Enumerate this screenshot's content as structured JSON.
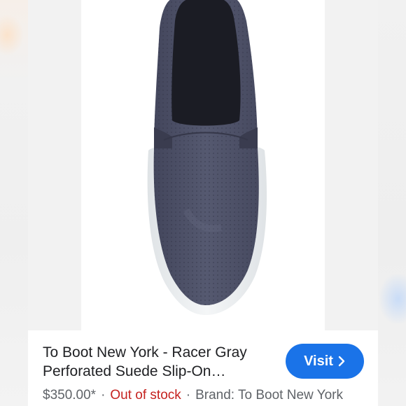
{
  "product": {
    "title_line1": "To Boot New York - Racer Gray",
    "title_line2": "Perforated Suede Slip-On…",
    "price": "$350.00*",
    "separator": "·",
    "stock_status": "Out of stock",
    "brand_text": "Brand: To Boot New York",
    "image_icon": "slip-on-shoe-photo"
  },
  "actions": {
    "visit_label": "Visit",
    "visit_icon": "chevron-right-icon"
  },
  "colors": {
    "accent": "#1a73e8",
    "stock_alert": "#c5221f",
    "shoe_suede": "#4a4d63",
    "sole": "#eaedef"
  }
}
